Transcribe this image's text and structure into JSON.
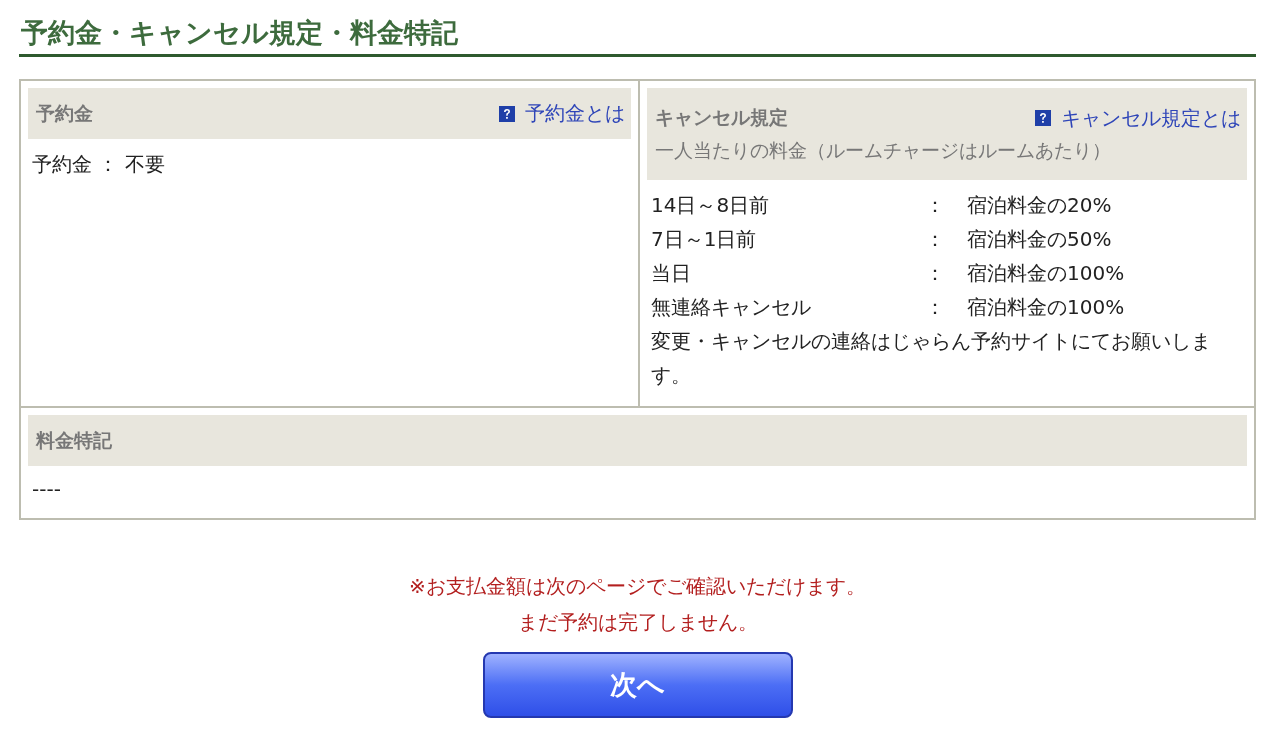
{
  "title": "予約金・キャンセル規定・料金特記",
  "deposit": {
    "heading": "予約金",
    "help_link": "予約金とは",
    "text": "予約金 ： 不要"
  },
  "cancel": {
    "heading": "キャンセル規定",
    "help_link": "キャンセル規定とは",
    "subheading": "一人当たりの料金（ルームチャージはルームあたり）",
    "rules": [
      {
        "when": "14日～8日前",
        "sep": "：",
        "fee": "宿泊料金の20%"
      },
      {
        "when": "7日～1日前",
        "sep": "：",
        "fee": "宿泊料金の50%"
      },
      {
        "when": "当日",
        "sep": "：",
        "fee": "宿泊料金の100%"
      },
      {
        "when": "無連絡キャンセル",
        "sep": "：",
        "fee": "宿泊料金の100%"
      }
    ],
    "note": "変更・キャンセルの連絡はじゃらん予約サイトにてお願いします。"
  },
  "special": {
    "heading": "料金特記",
    "text": "----"
  },
  "notices": [
    "※お支払金額は次のページでご確認いただけます。",
    "まだ予約は完了しません。"
  ],
  "next_button": "次へ"
}
